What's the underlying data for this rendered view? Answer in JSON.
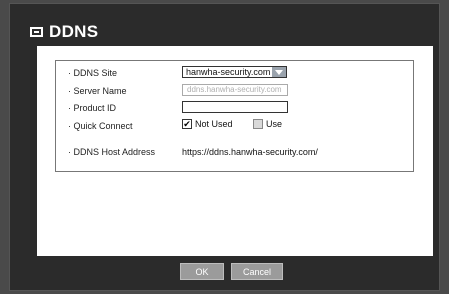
{
  "dialog": {
    "title": "DDNS",
    "icon": "window-icon"
  },
  "fields": {
    "ddns_site": {
      "label": "· DDNS Site",
      "value": "hanwha-security.com"
    },
    "server_name": {
      "label": "· Server Name",
      "placeholder": "ddns.hanwha-security.com"
    },
    "product_id": {
      "label": "· Product ID",
      "value": ""
    },
    "quick_connect": {
      "label": "· Quick Connect",
      "not_used_label": "Not Used",
      "not_used_checked": true,
      "use_label": "Use",
      "use_checked": false
    },
    "host_address": {
      "label": "· DDNS Host Address",
      "value": "https://ddns.hanwha-security.com/"
    }
  },
  "buttons": {
    "ok": "OK",
    "cancel": "Cancel"
  },
  "colors": {
    "background": "#2b2b2b",
    "panel": "#ffffff",
    "button": "#9b9b9b"
  }
}
